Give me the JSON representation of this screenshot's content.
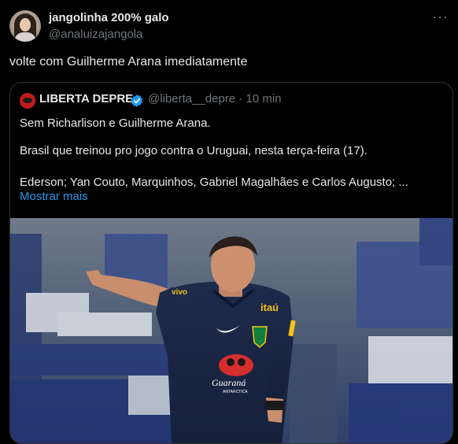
{
  "post": {
    "display_name": "jangolinha 200% galo",
    "handle": "@analuizajangola",
    "more": "···",
    "text": "volte com Guilherme Arana imediatamente"
  },
  "quote": {
    "name": "LIBERTA DEPRE",
    "handle": "@liberta__depre",
    "separator": "·",
    "time": "10 min",
    "lines": [
      "Sem Richarlison e Guilherme Arana.",
      "Brasil que treinou pro jogo contra o Uruguai, nesta terça-feira (17).",
      "Ederson; Yan Couto, Marquinhos, Gabriel Magalhães e Carlos Augusto; ..."
    ],
    "show_more": "Mostrar mais"
  },
  "photo": {
    "jersey_sponsor": "itaú",
    "chest_logo": "Guaraná",
    "chest_logo_sub": "ANTARCTICA",
    "sleeve_logo": "vivo"
  },
  "colors": {
    "background": "#000000",
    "text": "#e7e9ea",
    "muted": "#71767b",
    "link": "#1d9bf0",
    "border": "#2f3336",
    "verified": "#1d9bf0"
  },
  "icons": {
    "verified": "verified-badge-icon",
    "more": "more-options-icon"
  }
}
